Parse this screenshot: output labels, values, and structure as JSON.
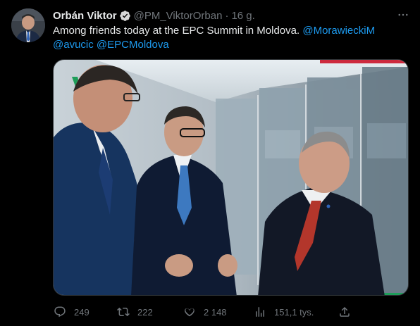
{
  "tweet": {
    "author": {
      "display_name": "Orbán Viktor",
      "handle": "@PM_ViktorOrban",
      "verified": true,
      "avatar_icon": "avatar-photo"
    },
    "separator": "·",
    "time": "16 g.",
    "more_icon": "more-dots-icon",
    "text_main": "Among friends today at the EPC Summit in Moldova.",
    "mentions": [
      "@MorawieckiM",
      "@avucic",
      "@EPCMoldova"
    ],
    "media": {
      "type": "photo",
      "accent_colors": [
        "#cd2a3e",
        "#ffffff",
        "#1e9e5a"
      ]
    },
    "actions": {
      "reply": {
        "icon": "reply-icon",
        "count": "249"
      },
      "retweet": {
        "icon": "retweet-icon",
        "count": "222"
      },
      "like": {
        "icon": "heart-icon",
        "count": "2 148"
      },
      "views": {
        "icon": "views-chart-icon",
        "count": "151,1 tys."
      },
      "share": {
        "icon": "share-icon"
      }
    },
    "colors": {
      "background": "#000000",
      "text": "#e7e9ea",
      "secondary": "#71767b",
      "link": "#1d9bf0",
      "verified": "#d9d9d9"
    }
  }
}
